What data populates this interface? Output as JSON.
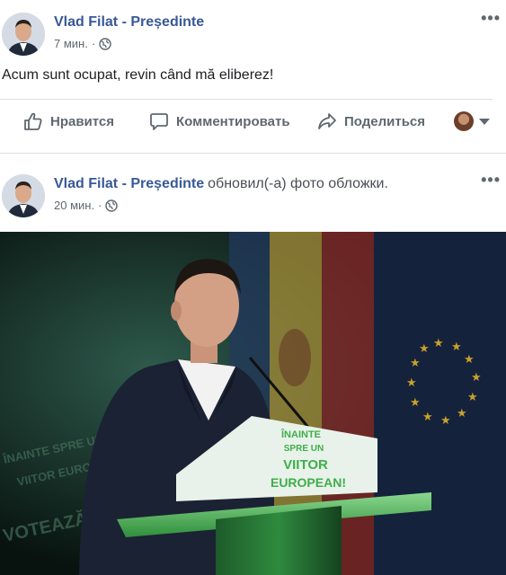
{
  "posts": [
    {
      "author": "Vlad Filat - Președinte",
      "time": "7 мин.",
      "privacy_icon": "globe-icon",
      "text": "Acum sunt ocupat, revin când mă eliberez!",
      "more_label": "•••"
    },
    {
      "author": "Vlad Filat - Președinte",
      "action": "обновил(-а) фото обложки.",
      "time": "20 мин.",
      "privacy_icon": "globe-icon",
      "more_label": "•••",
      "image_text": {
        "podium_line1": "ÎNAINTE",
        "podium_line2": "SPRE UN",
        "podium_line3": "VIITOR",
        "podium_line4": "EUROPEAN!",
        "backdrop_line1": "ÎNAINTE SPRE UN",
        "backdrop_line2": "VIITOR EUROPEAN!",
        "backdrop_line3": "VOTEAZĂ PL"
      }
    }
  ],
  "actions": {
    "like": "Нравится",
    "comment": "Комментировать",
    "share": "Поделиться"
  },
  "colors": {
    "author_link": "#385898",
    "secondary_text": "#616770",
    "action_text": "#606770",
    "podium_green": "#3fae49"
  }
}
